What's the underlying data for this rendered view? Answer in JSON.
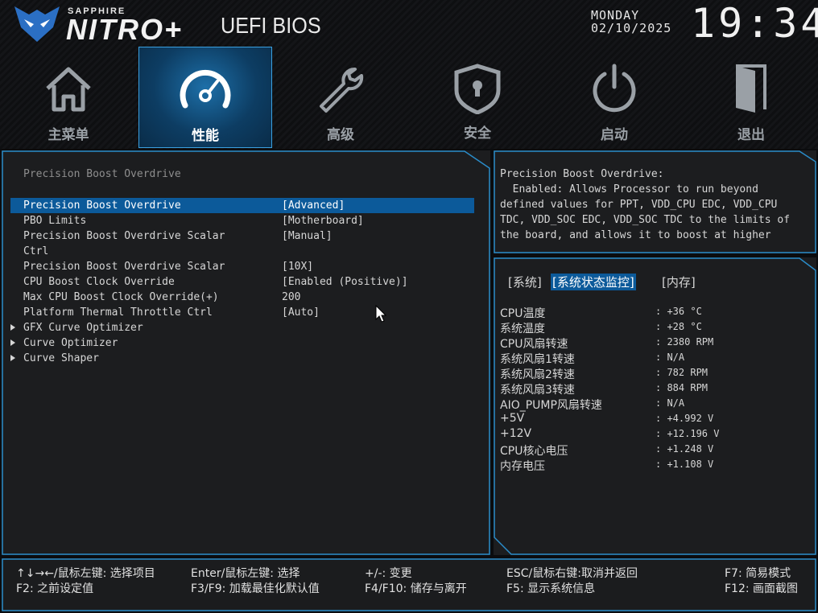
{
  "header": {
    "brand_small": "SAPPHIRE",
    "brand_big": "NITRO+",
    "bios_title": "UEFI BIOS",
    "day": "MONDAY",
    "date": "02/10/2025",
    "time": "19:34"
  },
  "tabs": [
    {
      "label": "主菜单",
      "icon": "home-icon"
    },
    {
      "label": "性能",
      "icon": "speedometer-icon",
      "active": true
    },
    {
      "label": "高级",
      "icon": "wrench-icon"
    },
    {
      "label": "安全",
      "icon": "shield-lock-icon"
    },
    {
      "label": "启动",
      "icon": "power-icon"
    },
    {
      "label": "退出",
      "icon": "exit-door-icon"
    }
  ],
  "settings": {
    "section_title": "Precision Boost Overdrive",
    "rows": [
      {
        "label": "Precision Boost Overdrive",
        "value": "[Advanced]",
        "selected": true
      },
      {
        "label": "PBO Limits",
        "value": "[Motherboard]"
      },
      {
        "label": "Precision Boost Overdrive Scalar",
        "value": "[Manual]"
      },
      {
        "label": "Ctrl",
        "value": ""
      },
      {
        "label": "Precision Boost Overdrive Scalar",
        "value": "[10X]"
      },
      {
        "label": "CPU Boost Clock Override",
        "value": "[Enabled (Positive)]"
      },
      {
        "label": "Max CPU Boost Clock Override(+)",
        "value": "200"
      },
      {
        "label": "Platform Thermal Throttle Ctrl",
        "value": "[Auto]"
      },
      {
        "label": "GFX Curve Optimizer",
        "value": "",
        "submenu": true
      },
      {
        "label": "Curve Optimizer",
        "value": "",
        "submenu": true
      },
      {
        "label": "Curve Shaper",
        "value": "",
        "submenu": true
      }
    ]
  },
  "help": {
    "text": "Precision Boost Overdrive:\n  Enabled: Allows Processor to run beyond\ndefined values for PPT, VDD_CPU EDC, VDD_CPU\nTDC, VDD_SOC EDC, VDD_SOC TDC to the limits of\nthe board, and allows it to boost at higher"
  },
  "monitor": {
    "tabs": [
      "[系统]",
      "[系统状态监控]",
      "[内存]"
    ],
    "active_tab": 1,
    "rows": [
      {
        "key": "CPU温度",
        "value": ": +36 °C"
      },
      {
        "key": "系统温度",
        "value": ": +28 °C"
      },
      {
        "key": "CPU风扇转速",
        "value": ": 2380 RPM"
      },
      {
        "key": "系统风扇1转速",
        "value": ": N/A"
      },
      {
        "key": "系统风扇2转速",
        "value": ": 782 RPM"
      },
      {
        "key": "系统风扇3转速",
        "value": ": 884 RPM"
      },
      {
        "key": "AIO_PUMP风扇转速",
        "value": ": N/A"
      },
      {
        "key": "+5V",
        "value": ": +4.992 V"
      },
      {
        "key": "+12V",
        "value": ": +12.196 V"
      },
      {
        "key": "CPU核心电压",
        "value": ": +1.248 V"
      },
      {
        "key": "内存电压",
        "value": ": +1.108 V"
      }
    ]
  },
  "footer": {
    "c1r1": "↑↓→←/鼠标左键: 选择项目",
    "c1r2": "F2: 之前设定值",
    "c2r1": "Enter/鼠标左键: 选择",
    "c2r2": "F3/F9: 加载最佳化默认值",
    "c3r1": "+/-: 变更",
    "c3r2": "F4/F10: 储存与离开",
    "c4r1": "ESC/鼠标右键:取消并返回",
    "c4r2": "F5: 显示系统信息",
    "c5r1": "F7: 简易模式",
    "c5r2": "F12: 画面截图"
  },
  "colors": {
    "accent": "#0c5a9a",
    "border": "#2a8cc9",
    "background": "#1c1d1f"
  }
}
